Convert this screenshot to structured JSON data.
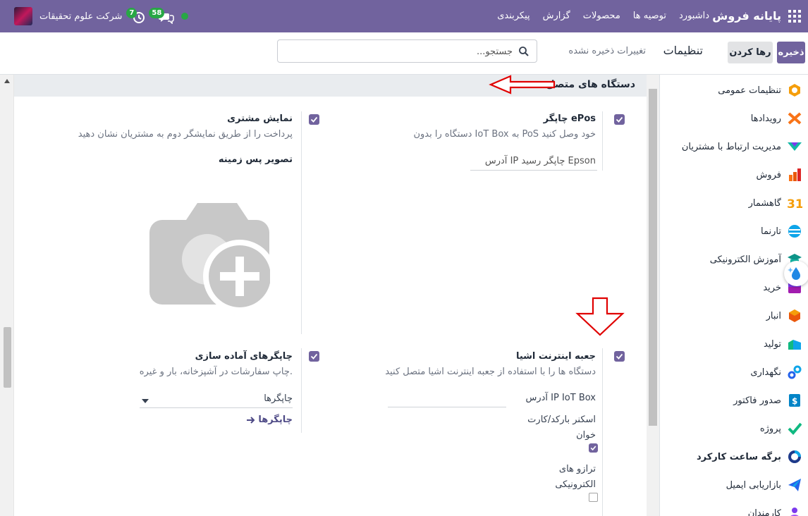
{
  "navbar": {
    "brand": "پایانه فروش",
    "menu": [
      "داشبورد",
      "توصیه ها",
      "محصولات",
      "گزارش",
      "پیکربندی"
    ],
    "company": "شرکت علوم تحقیقات",
    "activity_count": "7",
    "messages_count": "58"
  },
  "control_panel": {
    "save_label": "ذخیره",
    "discard_label": "رها کردن",
    "title": "تنظیمات",
    "unsaved": "تغییرات ذخیره نشده",
    "search_placeholder": "جستجو..."
  },
  "section": {
    "title": "دستگاه های متصل"
  },
  "settings": {
    "epos": {
      "title": "چاپگر ePos",
      "desc": "دستگاه را بدون IoT Box به PoS خود وصل کنید",
      "field_placeholder": "آدرس IP چاپگر رسید Epson",
      "checked": true
    },
    "customer_display": {
      "title": "نمایش مشتری",
      "desc": "پرداخت را از طریق نمایشگر دوم به مشتریان نشان دهید",
      "bg_label": "تصویر پس زمینه",
      "checked": true
    },
    "iot_box": {
      "title": "جعبه اینترنت اشیا",
      "desc": "دستگاه ها را با استفاده از جعبه اینترنت اشیا متصل کنید",
      "ip_label": "آدرس IP IoT Box",
      "scanner_label_1": "اسکنر بارکد/کارت",
      "scanner_label_2": "خوان",
      "scale_label_1": "ترازو های",
      "scale_label_2": "الکترونیکی",
      "checked": true,
      "scanner_checked": true,
      "scale_checked": false
    },
    "prep_printers": {
      "title": "چاپگرهای آماده سازی",
      "desc": "چاپ سفارشات در آشپزخانه، بار و غیره.",
      "field_value": "چاپگرها",
      "link": "چاپگرها",
      "checked": true
    }
  },
  "sidebar": {
    "items": [
      {
        "label": "تنظیمات عمومی",
        "icon": "general-settings-icon"
      },
      {
        "label": "رویدادها",
        "icon": "events-icon"
      },
      {
        "label": "مدیریت ارتباط با مشتریان",
        "icon": "crm-icon"
      },
      {
        "label": "فروش",
        "icon": "sales-icon"
      },
      {
        "label": "گاهشمار",
        "icon": "calendar-icon"
      },
      {
        "label": "تارنما",
        "icon": "website-icon"
      },
      {
        "label": "آموزش الکترونیکی",
        "icon": "elearning-icon"
      },
      {
        "label": "خرید",
        "icon": "purchase-icon"
      },
      {
        "label": "انبار",
        "icon": "inventory-icon"
      },
      {
        "label": "تولید",
        "icon": "manufacturing-icon"
      },
      {
        "label": "نگهداری",
        "icon": "maintenance-icon"
      },
      {
        "label": "صدور فاکتور",
        "icon": "invoicing-icon"
      },
      {
        "label": "پروژه",
        "icon": "project-icon"
      },
      {
        "label": "برگه ساعت کارکرد",
        "icon": "timesheet-icon"
      },
      {
        "label": "بازاریابی ایمیل",
        "icon": "email-marketing-icon"
      },
      {
        "label": "کارمندان",
        "icon": "employees-icon"
      }
    ]
  },
  "colors": {
    "primary": "#71639e",
    "annotation": "#e00000"
  }
}
